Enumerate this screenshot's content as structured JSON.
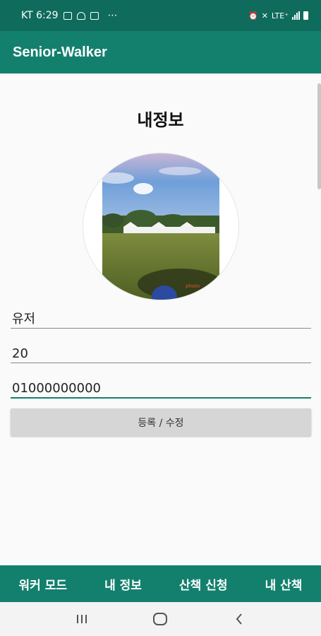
{
  "status_bar": {
    "carrier_time": "KT 6:29",
    "overflow": "⋯",
    "network": "LTE⁺"
  },
  "app_bar": {
    "title": "Senior-Walker"
  },
  "page": {
    "title": "내정보"
  },
  "form": {
    "name_value": "유저",
    "age_value": "20",
    "phone_value": "01000000000",
    "submit_label": "등록 / 수정"
  },
  "bottom_nav": {
    "items": [
      {
        "label": "워커 모드"
      },
      {
        "label": "내 정보"
      },
      {
        "label": "산책 신청"
      },
      {
        "label": "내 산책"
      }
    ]
  },
  "colors": {
    "status_bar": "#0f6b5c",
    "primary": "#13806e",
    "button": "#d6d6d6"
  },
  "icons": [
    "notification-icon",
    "image-icon",
    "cloud-icon",
    "mail-icon",
    "alarm-icon",
    "mute-icon",
    "wifi-icon",
    "signal-icon",
    "battery-icon",
    "recent-apps-icon",
    "home-icon",
    "back-icon"
  ]
}
